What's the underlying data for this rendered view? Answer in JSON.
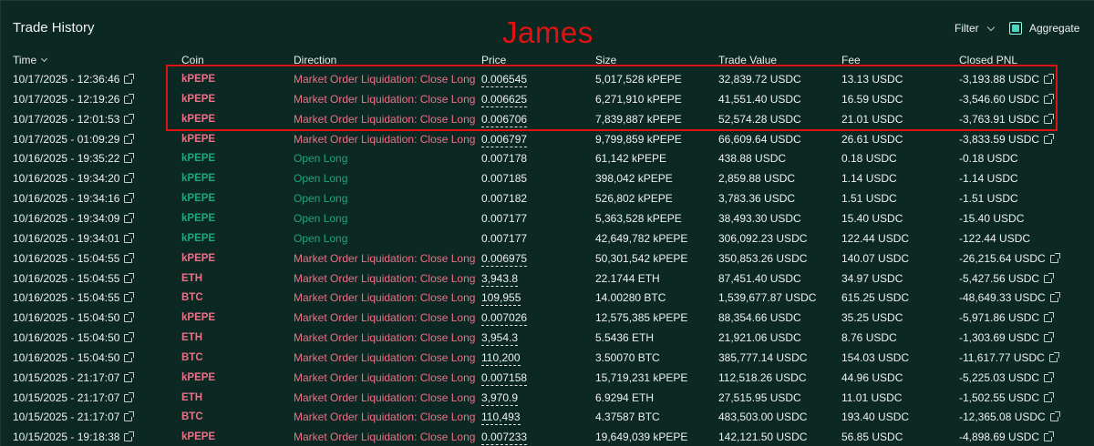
{
  "panel": {
    "title": "Trade History",
    "annotation": "James",
    "filter_label": "Filter",
    "aggregate_label": "Aggregate",
    "aggregate_checked": true
  },
  "columns": {
    "time": "Time",
    "coin": "Coin",
    "direction": "Direction",
    "price": "Price",
    "size": "Size",
    "trade_value": "Trade Value",
    "fee": "Fee",
    "closed_pnl": "Closed PNL"
  },
  "colors": {
    "sell": "#ed7088",
    "buy": "#1fa67d",
    "annotation": "#e01212",
    "accent": "#50d2c1"
  },
  "rows": [
    {
      "time": "10/17/2025 - 12:36:46",
      "time_link": true,
      "coin": "kPEPE",
      "side": "sell",
      "direction": "Market Order Liquidation: Close Long",
      "price": "0.006545",
      "price_dotted": true,
      "size": "5,017,528 kPEPE",
      "value": "32,839.72 USDC",
      "fee": "13.13 USDC",
      "pnl": "-3,193.88 USDC",
      "pnl_link": true
    },
    {
      "time": "10/17/2025 - 12:19:26",
      "time_link": true,
      "coin": "kPEPE",
      "side": "sell",
      "direction": "Market Order Liquidation: Close Long",
      "price": "0.006625",
      "price_dotted": true,
      "size": "6,271,910 kPEPE",
      "value": "41,551.40 USDC",
      "fee": "16.59 USDC",
      "pnl": "-3,546.60 USDC",
      "pnl_link": true
    },
    {
      "time": "10/17/2025 - 12:01:53",
      "time_link": true,
      "coin": "kPEPE",
      "side": "sell",
      "direction": "Market Order Liquidation: Close Long",
      "price": "0.006706",
      "price_dotted": true,
      "size": "7,839,887 kPEPE",
      "value": "52,574.28 USDC",
      "fee": "21.01 USDC",
      "pnl": "-3,763.91 USDC",
      "pnl_link": true
    },
    {
      "time": "10/17/2025 - 01:09:29",
      "time_link": true,
      "coin": "kPEPE",
      "side": "sell",
      "direction": "Market Order Liquidation: Close Long",
      "price": "0.006797",
      "price_dotted": true,
      "size": "9,799,859 kPEPE",
      "value": "66,609.64 USDC",
      "fee": "26.61 USDC",
      "pnl": "-3,833.59 USDC",
      "pnl_link": true
    },
    {
      "time": "10/16/2025 - 19:35:22",
      "time_link": true,
      "coin": "kPEPE",
      "side": "buy",
      "direction": "Open Long",
      "price": "0.007178",
      "price_dotted": false,
      "size": "61,142 kPEPE",
      "value": "438.88 USDC",
      "fee": "0.18 USDC",
      "pnl": "-0.18 USDC",
      "pnl_link": false
    },
    {
      "time": "10/16/2025 - 19:34:20",
      "time_link": true,
      "coin": "kPEPE",
      "side": "buy",
      "direction": "Open Long",
      "price": "0.007185",
      "price_dotted": false,
      "size": "398,042 kPEPE",
      "value": "2,859.88 USDC",
      "fee": "1.14 USDC",
      "pnl": "-1.14 USDC",
      "pnl_link": false
    },
    {
      "time": "10/16/2025 - 19:34:16",
      "time_link": true,
      "coin": "kPEPE",
      "side": "buy",
      "direction": "Open Long",
      "price": "0.007182",
      "price_dotted": false,
      "size": "526,802 kPEPE",
      "value": "3,783.36 USDC",
      "fee": "1.51 USDC",
      "pnl": "-1.51 USDC",
      "pnl_link": false
    },
    {
      "time": "10/16/2025 - 19:34:09",
      "time_link": true,
      "coin": "kPEPE",
      "side": "buy",
      "direction": "Open Long",
      "price": "0.007177",
      "price_dotted": false,
      "size": "5,363,528 kPEPE",
      "value": "38,493.30 USDC",
      "fee": "15.40 USDC",
      "pnl": "-15.40 USDC",
      "pnl_link": false
    },
    {
      "time": "10/16/2025 - 19:34:01",
      "time_link": true,
      "coin": "kPEPE",
      "side": "buy",
      "direction": "Open Long",
      "price": "0.007177",
      "price_dotted": false,
      "size": "42,649,782 kPEPE",
      "value": "306,092.23 USDC",
      "fee": "122.44 USDC",
      "pnl": "-122.44 USDC",
      "pnl_link": false
    },
    {
      "time": "10/16/2025 - 15:04:55",
      "time_link": true,
      "coin": "kPEPE",
      "side": "sell",
      "direction": "Market Order Liquidation: Close Long",
      "price": "0.006975",
      "price_dotted": true,
      "size": "50,301,542 kPEPE",
      "value": "350,853.26 USDC",
      "fee": "140.07 USDC",
      "pnl": "-26,215.64 USDC",
      "pnl_link": true
    },
    {
      "time": "10/16/2025 - 15:04:55",
      "time_link": true,
      "coin": "ETH",
      "side": "sell",
      "direction": "Market Order Liquidation: Close Long",
      "price": "3,943.8",
      "price_dotted": true,
      "size": "22.1744 ETH",
      "value": "87,451.40 USDC",
      "fee": "34.97 USDC",
      "pnl": "-5,427.56 USDC",
      "pnl_link": true
    },
    {
      "time": "10/16/2025 - 15:04:55",
      "time_link": true,
      "coin": "BTC",
      "side": "sell",
      "direction": "Market Order Liquidation: Close Long",
      "price": "109,955",
      "price_dotted": true,
      "size": "14.00280 BTC",
      "value": "1,539,677.87 USDC",
      "fee": "615.25 USDC",
      "pnl": "-48,649.33 USDC",
      "pnl_link": true
    },
    {
      "time": "10/16/2025 - 15:04:50",
      "time_link": true,
      "coin": "kPEPE",
      "side": "sell",
      "direction": "Market Order Liquidation: Close Long",
      "price": "0.007026",
      "price_dotted": true,
      "size": "12,575,385 kPEPE",
      "value": "88,354.66 USDC",
      "fee": "35.25 USDC",
      "pnl": "-5,971.86 USDC",
      "pnl_link": true
    },
    {
      "time": "10/16/2025 - 15:04:50",
      "time_link": true,
      "coin": "ETH",
      "side": "sell",
      "direction": "Market Order Liquidation: Close Long",
      "price": "3,954.3",
      "price_dotted": true,
      "size": "5.5436 ETH",
      "value": "21,921.06 USDC",
      "fee": "8.76 USDC",
      "pnl": "-1,303.69 USDC",
      "pnl_link": true
    },
    {
      "time": "10/16/2025 - 15:04:50",
      "time_link": true,
      "coin": "BTC",
      "side": "sell",
      "direction": "Market Order Liquidation: Close Long",
      "price": "110,200",
      "price_dotted": true,
      "size": "3.50070 BTC",
      "value": "385,777.14 USDC",
      "fee": "154.03 USDC",
      "pnl": "-11,617.77 USDC",
      "pnl_link": true
    },
    {
      "time": "10/15/2025 - 21:17:07",
      "time_link": true,
      "coin": "kPEPE",
      "side": "sell",
      "direction": "Market Order Liquidation: Close Long",
      "price": "0.007158",
      "price_dotted": true,
      "size": "15,719,231 kPEPE",
      "value": "112,518.26 USDC",
      "fee": "44.96 USDC",
      "pnl": "-5,225.03 USDC",
      "pnl_link": true
    },
    {
      "time": "10/15/2025 - 21:17:07",
      "time_link": true,
      "coin": "ETH",
      "side": "sell",
      "direction": "Market Order Liquidation: Close Long",
      "price": "3,970.9",
      "price_dotted": true,
      "size": "6.9294 ETH",
      "value": "27,515.95 USDC",
      "fee": "11.01 USDC",
      "pnl": "-1,502.55 USDC",
      "pnl_link": true
    },
    {
      "time": "10/15/2025 - 21:17:07",
      "time_link": true,
      "coin": "BTC",
      "side": "sell",
      "direction": "Market Order Liquidation: Close Long",
      "price": "110,493",
      "price_dotted": true,
      "size": "4.37587 BTC",
      "value": "483,503.00 USDC",
      "fee": "193.40 USDC",
      "pnl": "-12,365.08 USDC",
      "pnl_link": true
    },
    {
      "time": "10/15/2025 - 19:18:38",
      "time_link": true,
      "coin": "kPEPE",
      "side": "sell",
      "direction": "Market Order Liquidation: Close Long",
      "price": "0.007233",
      "price_dotted": true,
      "size": "19,649,039 kPEPE",
      "value": "142,121.50 USDC",
      "fee": "56.85 USDC",
      "pnl": "-4,898.69 USDC",
      "pnl_link": true
    }
  ]
}
